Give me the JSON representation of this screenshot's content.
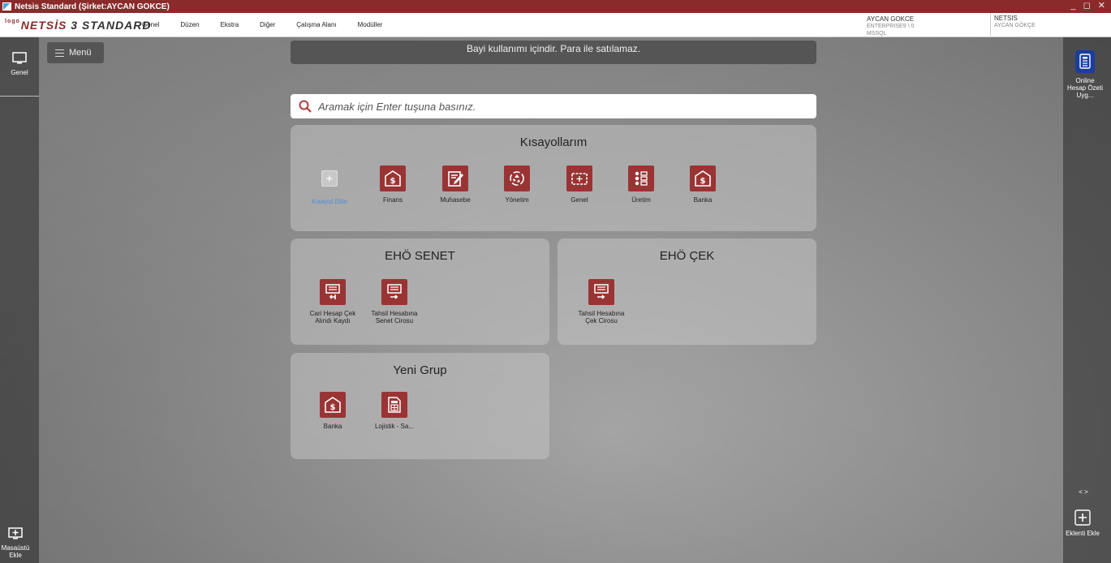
{
  "window": {
    "title": "Netsis Standard (Şirket:AYCAN GOKCE)",
    "controls": "_ ◻ ✕"
  },
  "logo": {
    "prefix": "logo",
    "brand": "NETSİS",
    "edition": "3 STANDARD"
  },
  "menu": [
    "Genel",
    "Düzen",
    "Ekstra",
    "Diğer",
    "Çalışma Alanı",
    "Modüller"
  ],
  "user": {
    "name": "AYCAN GOKCE",
    "db": "ENTERPRISE9 \\ 0",
    "server": "MSSQL"
  },
  "company": {
    "name": "NETSIS",
    "user": "AYCAN GÖKÇE"
  },
  "left_sidebar": {
    "genel_label": "Genel",
    "add_desktop_label": "Masaüstü Ekle"
  },
  "right_sidebar": {
    "online_label": "Online Hesap Özeti Uyg...",
    "nav": "<  >",
    "add_plugin_label": "Eklenti Ekle"
  },
  "menu_button": "Menü",
  "notice": "Bayi kullanımı içindir. Para ile satılamaz.",
  "search": {
    "placeholder": "Aramak için Enter tuşuna basınız."
  },
  "shortcuts": {
    "title": "Kısayollarım",
    "add_label": "Kısayol Ekle",
    "items": [
      {
        "label": "Finans",
        "icon": "dollar-icon"
      },
      {
        "label": "Muhasebe",
        "icon": "ledger-edit-icon"
      },
      {
        "label": "Yönetim",
        "icon": "recycle-icon"
      },
      {
        "label": "Genel",
        "icon": "dashboard-icon"
      },
      {
        "label": "Üretim",
        "icon": "checklist-icon"
      },
      {
        "label": "Banka",
        "icon": "dollar-icon"
      }
    ]
  },
  "group_senet": {
    "title": "EHÖ SENET",
    "items": [
      {
        "label": "Cari Hesap Çek Alındı Kaydı",
        "icon": "check-in-icon"
      },
      {
        "label": "Tahsil Hesabına Senet Cirosu",
        "icon": "check-out-icon"
      }
    ]
  },
  "group_cek": {
    "title": "EHÖ ÇEK",
    "items": [
      {
        "label": "Tahsil Hesabına Çek Cirosu",
        "icon": "check-out-icon"
      }
    ]
  },
  "group_new": {
    "title": "Yeni Grup",
    "items": [
      {
        "label": "Banka",
        "icon": "dollar-icon"
      },
      {
        "label": "Lojistik - Sa...",
        "icon": "calculator-icon"
      }
    ]
  }
}
